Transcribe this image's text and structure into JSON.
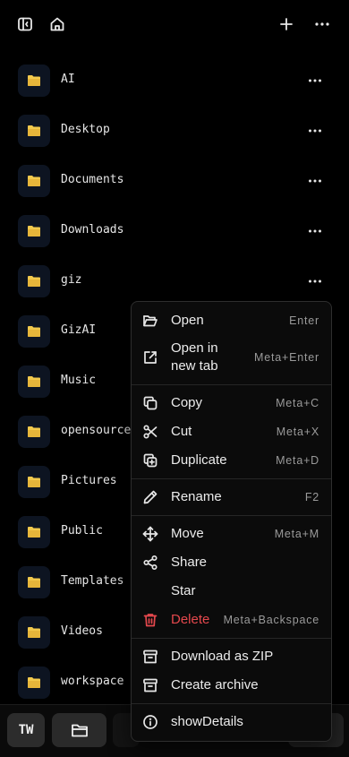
{
  "topbar": {
    "icons": [
      "sidebar-toggle-icon",
      "home-icon",
      "plus-icon",
      "more-horizontal-icon"
    ]
  },
  "files": [
    {
      "name": "AI"
    },
    {
      "name": "Desktop"
    },
    {
      "name": "Documents"
    },
    {
      "name": "Downloads"
    },
    {
      "name": "giz"
    },
    {
      "name": "GizAI"
    },
    {
      "name": "Music"
    },
    {
      "name": "opensource"
    },
    {
      "name": "Pictures"
    },
    {
      "name": "Public"
    },
    {
      "name": "Templates"
    },
    {
      "name": "Videos"
    },
    {
      "name": "workspace"
    }
  ],
  "colors": {
    "folder_tile_bg": "#0d1421",
    "folder_icon": "#f2c94c",
    "danger": "#e5484d",
    "background": "#000000"
  },
  "context_menu": {
    "open": {
      "label": "Open",
      "shortcut": "Enter"
    },
    "open_new_tab": {
      "label": "Open in new tab",
      "shortcut": "Meta+Enter"
    },
    "copy": {
      "label": "Copy",
      "shortcut": "Meta+C"
    },
    "cut": {
      "label": "Cut",
      "shortcut": "Meta+X"
    },
    "duplicate": {
      "label": "Duplicate",
      "shortcut": "Meta+D"
    },
    "rename": {
      "label": "Rename",
      "shortcut": "F2"
    },
    "move": {
      "label": "Move",
      "shortcut": "Meta+M"
    },
    "share": {
      "label": "Share"
    },
    "star": {
      "label": "Star"
    },
    "delete": {
      "label": "Delete",
      "shortcut": "Meta+Backspace"
    },
    "download_zip": {
      "label": "Download as ZIP"
    },
    "create_archive": {
      "label": "Create archive"
    },
    "show_details": {
      "label": "showDetails"
    }
  },
  "bottombar": {
    "avatar_initials": "TW"
  }
}
